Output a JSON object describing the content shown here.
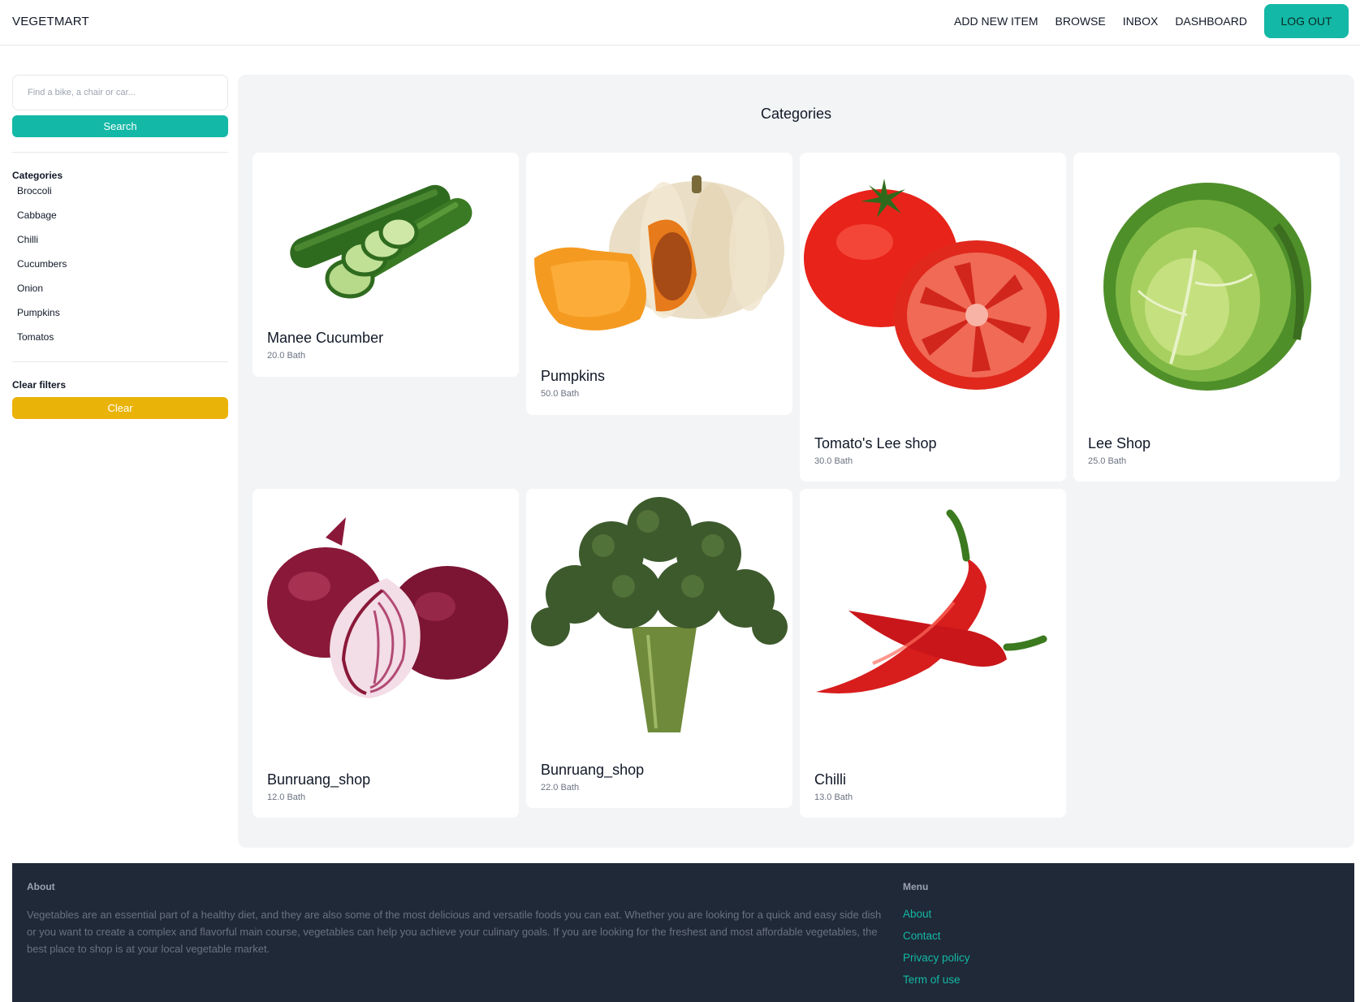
{
  "header": {
    "brand": "VEGETMART",
    "nav": [
      "ADD NEW ITEM",
      "BROWSE",
      "INBOX",
      "DASHBOARD"
    ],
    "logout": "LOG OUT"
  },
  "sidebar": {
    "search_placeholder": "Find a bike, a chair or car...",
    "search_button": "Search",
    "categories_heading": "Categories",
    "categories": [
      "Broccoli",
      "Cabbage",
      "Chilli",
      "Cucumbers",
      "Onion",
      "Pumpkins",
      "Tomatos"
    ],
    "clear_heading": "Clear filters",
    "clear_button": "Clear"
  },
  "main": {
    "title": "Categories",
    "items": [
      {
        "name": "Manee Cucumber",
        "price": "20.0 Bath",
        "image": "cucumber-image"
      },
      {
        "name": "Pumpkins",
        "price": "50.0 Bath",
        "image": "pumpkin-image"
      },
      {
        "name": "Tomato's Lee shop",
        "price": "30.0 Bath",
        "image": "tomato-image"
      },
      {
        "name": "Lee Shop",
        "price": "25.0 Bath",
        "image": "cabbage-image"
      },
      {
        "name": "Bunruang_shop",
        "price": "12.0 Bath",
        "image": "onion-image"
      },
      {
        "name": "Bunruang_shop",
        "price": "22.0 Bath",
        "image": "broccoli-image"
      },
      {
        "name": "Chilli",
        "price": "13.0 Bath",
        "image": "chilli-image"
      }
    ]
  },
  "footer": {
    "about_heading": "About",
    "about_text": "Vegetables are an essential part of a healthy diet, and they are also some of the most delicious and versatile foods you can eat. Whether you are looking for a quick and easy side dish or you want to create a complex and flavorful main course, vegetables can help you achieve your culinary goals. If you are looking for the freshest and most affordable vegetables, the best place to shop is at your local vegetable market.",
    "menu_heading": "Menu",
    "menu": [
      "About",
      "Contact",
      "Privacy policy",
      "Term of use"
    ]
  },
  "colors": {
    "accent": "#14b8a6",
    "clear": "#eab308",
    "footer_bg": "#1f2937",
    "panel_bg": "#f3f4f6"
  }
}
